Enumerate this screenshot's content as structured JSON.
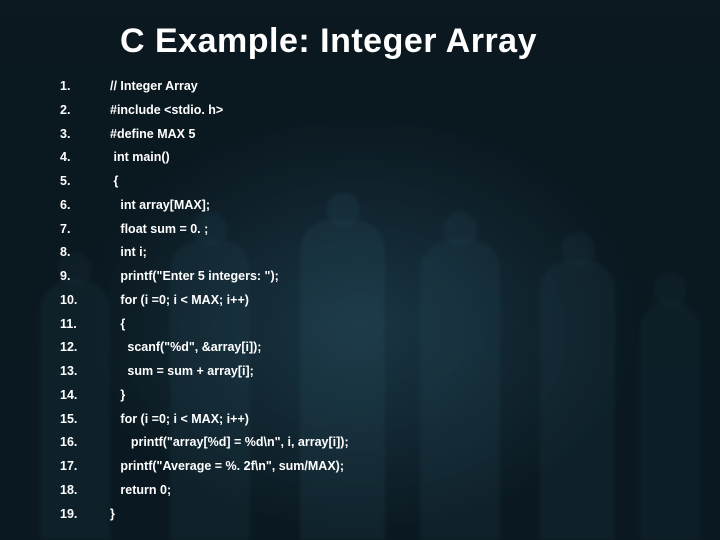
{
  "title": "C Example: Integer Array",
  "code": {
    "l1": "// Integer Array",
    "l2": "#include <stdio. h>",
    "l3": "#define MAX 5",
    "l4": " int main()",
    "l5": " {",
    "l6": "   int array[MAX];",
    "l7": "   float sum = 0. ;",
    "l8": "   int i;",
    "l9": "   printf(\"Enter 5 integers: \");",
    "l10": "   for (i =0; i < MAX; i++)",
    "l11": "   {",
    "l12": "     scanf(\"%d\", &array[i]);",
    "l13": "     sum = sum + array[i];",
    "l14": "   }",
    "l15": "   for (i =0; i < MAX; i++)",
    "l16": "      printf(\"array[%d] = %d\\n\", i, array[i]);",
    "l17": "   printf(\"Average = %. 2f\\n\", sum/MAX);",
    "l18": "   return 0;",
    "l19": "}"
  }
}
